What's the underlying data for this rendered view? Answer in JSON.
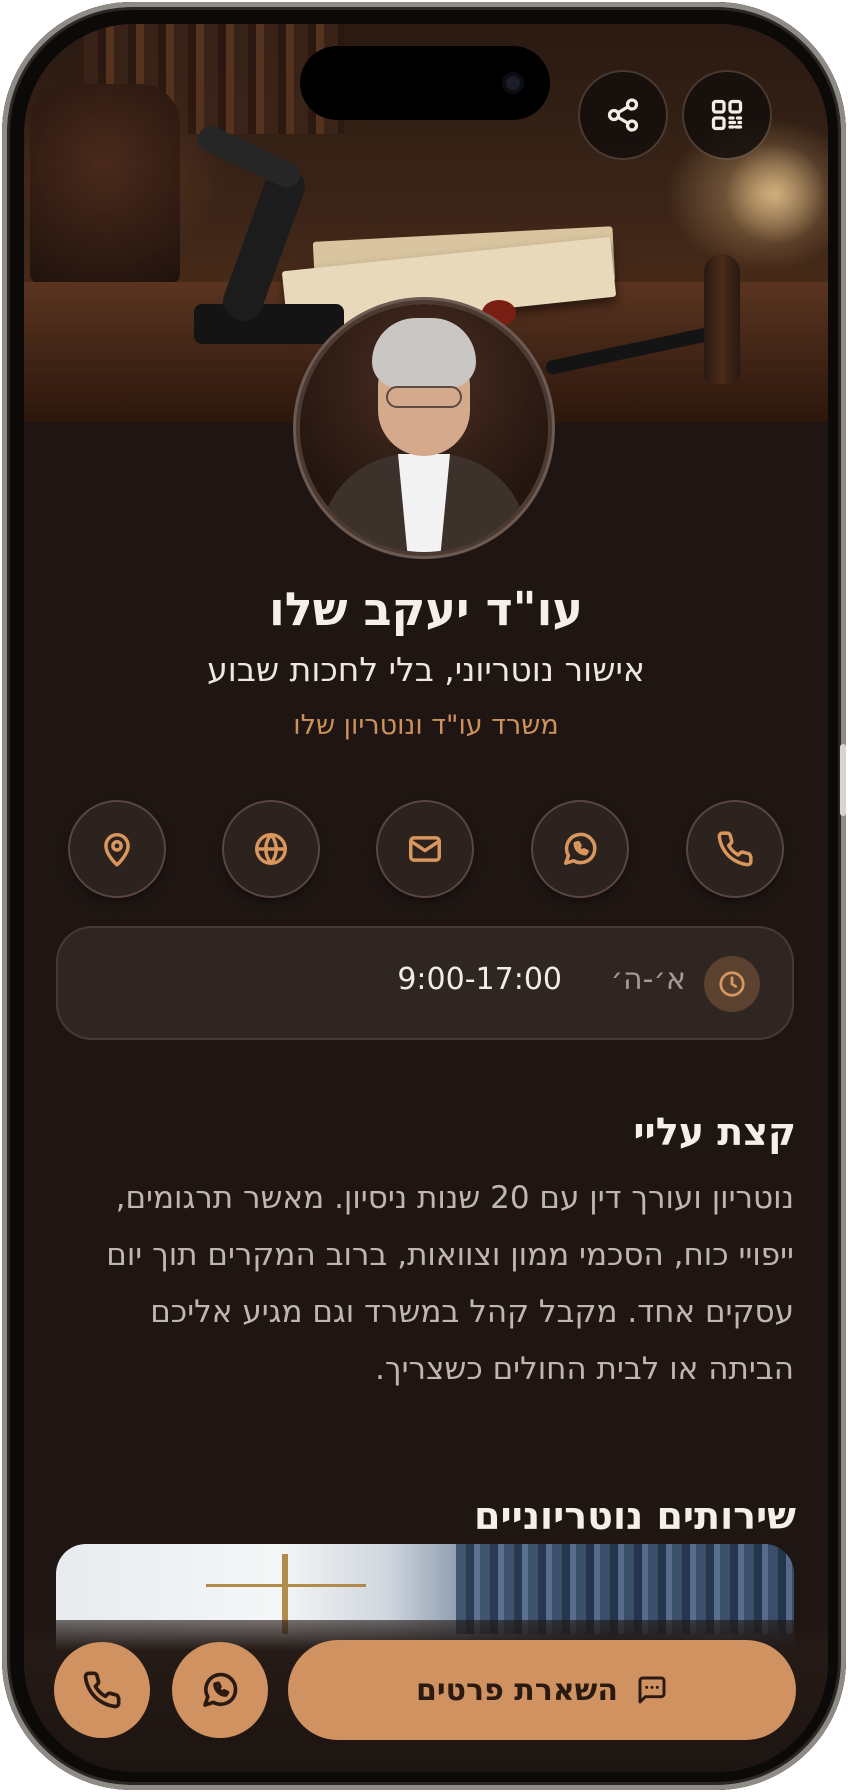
{
  "profile": {
    "name": "עו\"ד יעקב שלו",
    "tagline": "אישור נוטריוני, בלי לחכות שבוע",
    "office": "משרד עו\"ד ונוטריון שלו"
  },
  "header_actions": [
    {
      "icon": "qr-code-icon"
    },
    {
      "icon": "share-icon"
    }
  ],
  "contact_actions": [
    {
      "icon": "phone-icon"
    },
    {
      "icon": "whatsapp-icon"
    },
    {
      "icon": "mail-icon"
    },
    {
      "icon": "globe-icon"
    },
    {
      "icon": "location-pin-icon"
    }
  ],
  "hours": {
    "days": "א׳-ה׳",
    "time": "9:00-17:00"
  },
  "about": {
    "title": "קצת עליי",
    "text": "נוטריון ועורך דין עם 20 שנות ניסיון. מאשר תרגומים, ייפויי כוח, הסכמי ממון וצוואות, ברוב המקרים תוך יום עסקים אחד. מקבל קהל במשרד וגם מגיע אליכם הביתה או לבית החולים כשצריך."
  },
  "services": {
    "title": "שירותים נוטריוניים"
  },
  "bottom_bar": {
    "lead_label": "השארת פרטים"
  },
  "colors": {
    "accent": "#cf9260",
    "background": "#1f1613",
    "card": "#2f2622"
  }
}
